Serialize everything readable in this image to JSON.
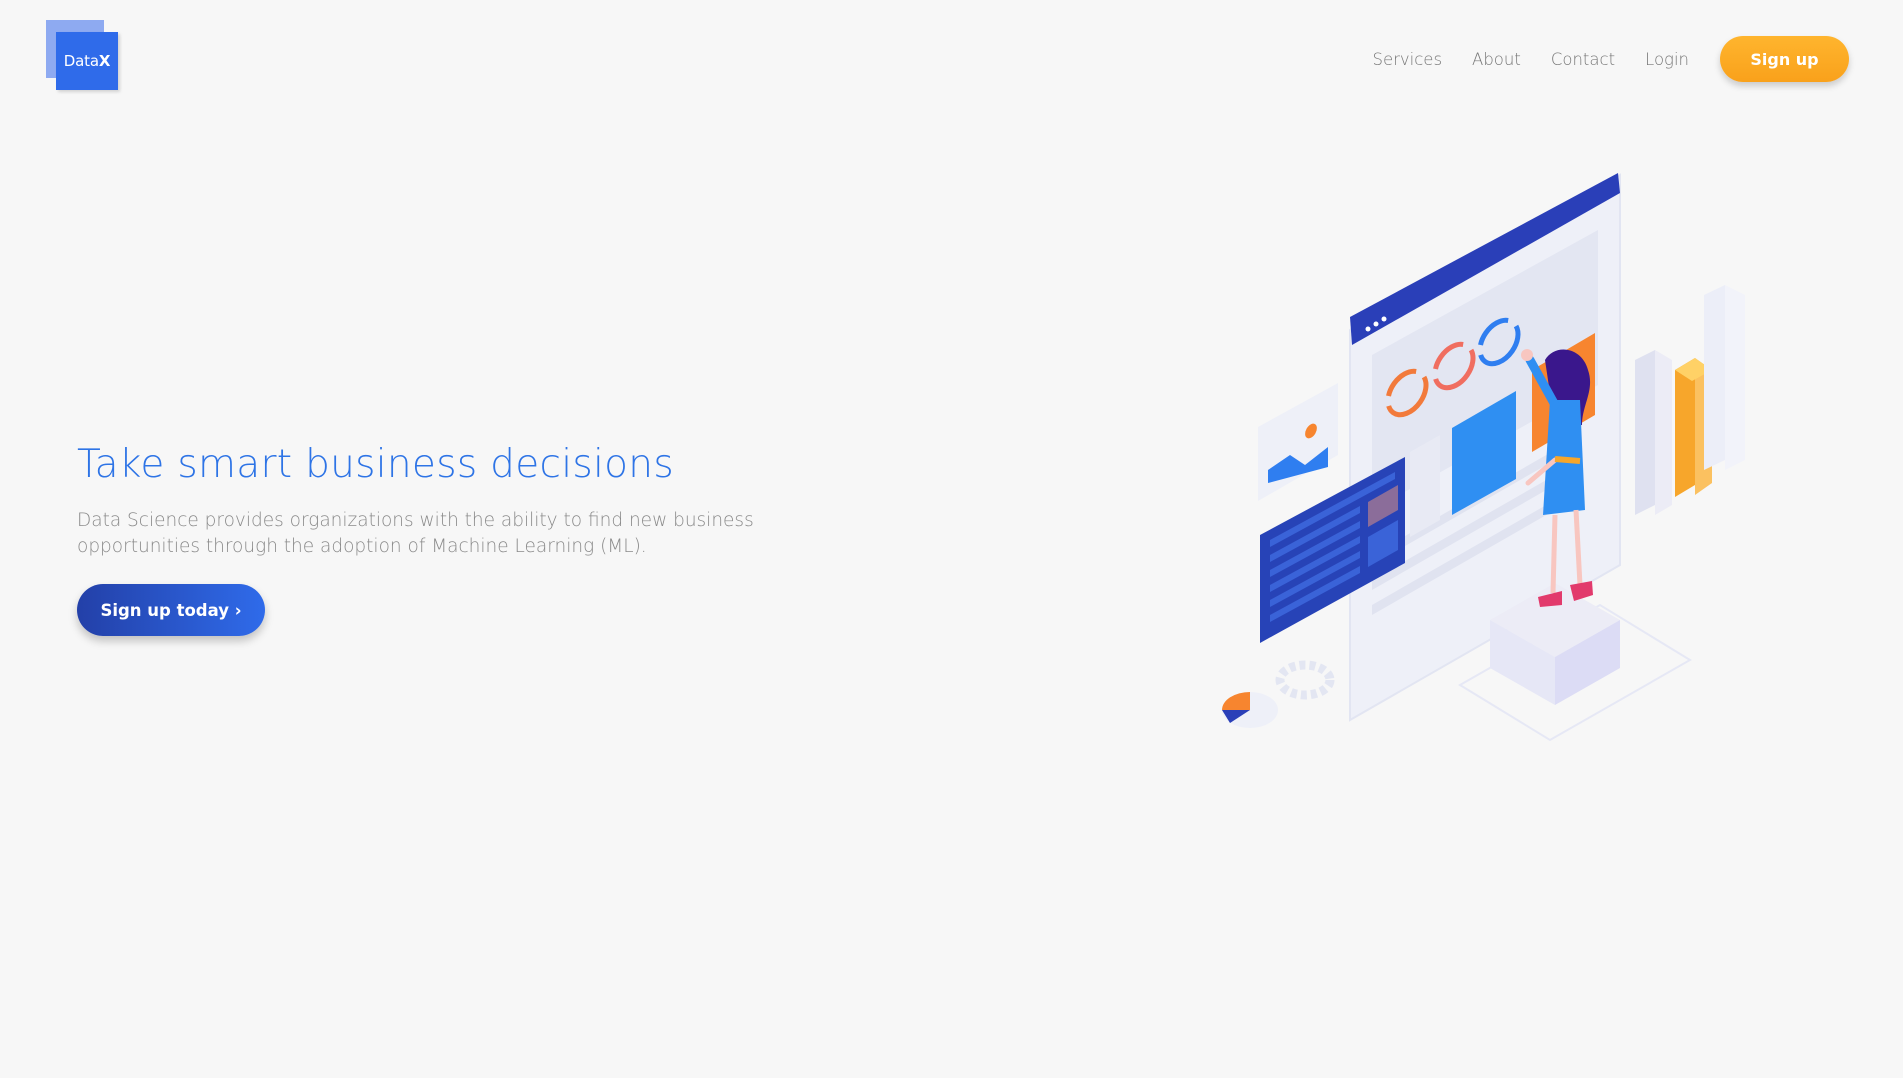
{
  "logo": {
    "text_plain": "Data",
    "text_bold": "X"
  },
  "nav": {
    "items": [
      "Services",
      "About",
      "Contact",
      "Login"
    ],
    "signup_label": "Sign up"
  },
  "hero": {
    "title": "Take smart business decisions",
    "description": "Data Science provides organizations with the ability to find new business opportunities through the adoption of Machine Learning (ML).",
    "cta_label": "Sign up today ›"
  },
  "colors": {
    "background": "#f7f7f7",
    "brand_blue": "#2f6bea",
    "accent_orange": "#ffb52e",
    "cta_dark_blue": "#2340a8",
    "nav_text": "#777777"
  }
}
